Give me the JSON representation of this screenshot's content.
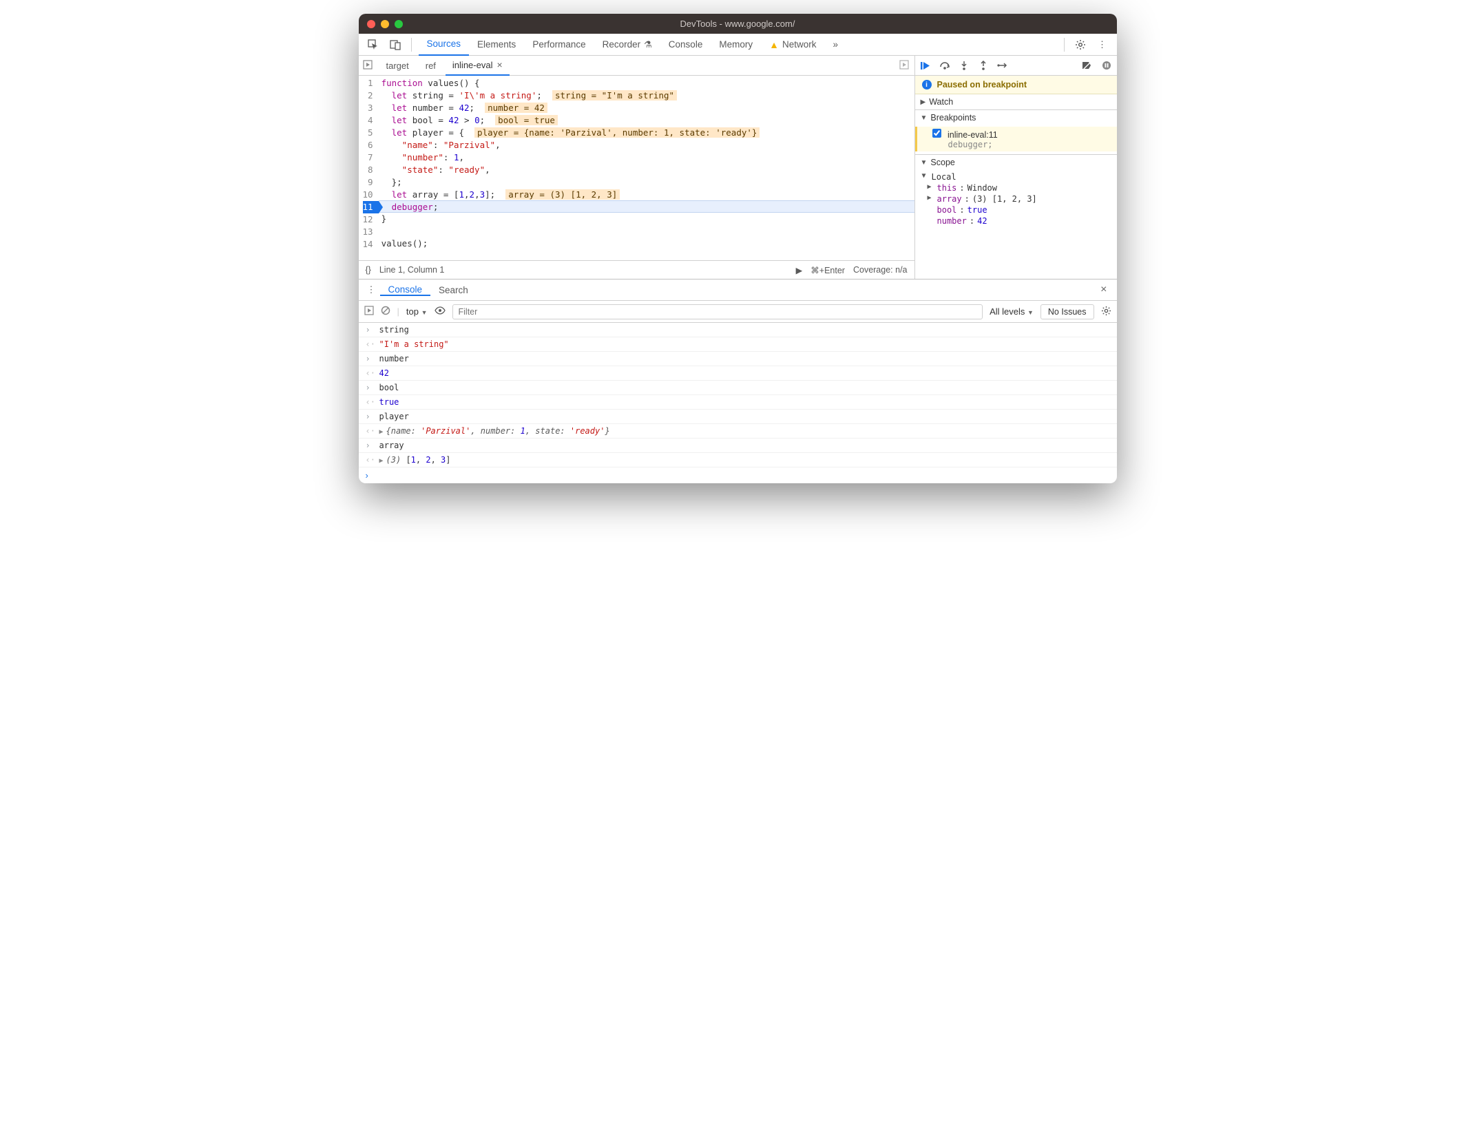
{
  "window": {
    "title": "DevTools - www.google.com/"
  },
  "mainTabs": [
    "Sources",
    "Elements",
    "Performance",
    "Recorder",
    "Console",
    "Memory",
    "Network"
  ],
  "mainTabActive": "Sources",
  "editorTabs": [
    {
      "label": "target",
      "active": false
    },
    {
      "label": "ref",
      "active": false
    },
    {
      "label": "inline-eval",
      "active": true,
      "closeable": true
    }
  ],
  "code": {
    "lines": [
      {
        "n": 1,
        "html": "<span class='tok-kw'>function</span> values() {"
      },
      {
        "n": 2,
        "html": "  <span class='tok-kw'>let</span> string = <span class='tok-str'>'I\\'m a string'</span>;  <span class='inline-eval'>string = \"I'm a string\"</span>"
      },
      {
        "n": 3,
        "html": "  <span class='tok-kw'>let</span> number = <span class='tok-num'>42</span>;  <span class='inline-eval'>number = 42</span>"
      },
      {
        "n": 4,
        "html": "  <span class='tok-kw'>let</span> bool = <span class='tok-num'>42</span> &gt; <span class='tok-num'>0</span>;  <span class='inline-eval'>bool = true</span>"
      },
      {
        "n": 5,
        "html": "  <span class='tok-kw'>let</span> player = {  <span class='inline-eval'>player = {name: 'Parzival', number: 1, state: 'ready'}</span>"
      },
      {
        "n": 6,
        "html": "    <span class='tok-prop'>\"name\"</span>: <span class='tok-str'>\"Parzival\"</span>,"
      },
      {
        "n": 7,
        "html": "    <span class='tok-prop'>\"number\"</span>: <span class='tok-num'>1</span>,"
      },
      {
        "n": 8,
        "html": "    <span class='tok-prop'>\"state\"</span>: <span class='tok-str'>\"ready\"</span>,"
      },
      {
        "n": 9,
        "html": "  };"
      },
      {
        "n": 10,
        "html": "  <span class='tok-kw'>let</span> array = [<span class='tok-num'>1</span>,<span class='tok-num'>2</span>,<span class='tok-num'>3</span>];  <span class='inline-eval'>array = (3) [1, 2, 3]</span>"
      },
      {
        "n": 11,
        "html": "  <span class='tok-dbg'>debugger</span>;",
        "current": true
      },
      {
        "n": 12,
        "html": "}"
      },
      {
        "n": 13,
        "html": ""
      },
      {
        "n": 14,
        "html": "values();"
      }
    ]
  },
  "editorStatus": {
    "pretty": "{}",
    "pos": "Line 1, Column 1",
    "runHint": "⌘+Enter",
    "coverage": "Coverage: n/a"
  },
  "debugger": {
    "bannerText": "Paused on breakpoint",
    "sections": {
      "watch": "Watch",
      "breakpoints": "Breakpoints",
      "scope": "Scope"
    },
    "breakpoint": {
      "source": "inline-eval:11",
      "line": "debugger;"
    },
    "scope": {
      "local": "Local",
      "rows": [
        {
          "name": "this",
          "value": "Window",
          "expandable": true
        },
        {
          "name": "array",
          "value": "(3) [1, 2, 3]",
          "expandable": true,
          "cls": "obj"
        },
        {
          "name": "bool",
          "value": "true",
          "cls": "bool"
        },
        {
          "name": "number",
          "value": "42",
          "cls": "num"
        }
      ]
    }
  },
  "drawer": {
    "tabs": [
      "Console",
      "Search"
    ],
    "active": "Console",
    "toolbar": {
      "context": "top",
      "filterPlaceholder": "Filter",
      "levels": "All levels",
      "issues": "No Issues"
    },
    "logs": [
      {
        "dir": "in",
        "html": "string"
      },
      {
        "dir": "out",
        "html": "<span class='cstr'>\"I'm a string\"</span>"
      },
      {
        "dir": "in",
        "html": "number"
      },
      {
        "dir": "out",
        "html": "<span class='cnum'>42</span>"
      },
      {
        "dir": "in",
        "html": "bool"
      },
      {
        "dir": "out",
        "html": "<span class='cbool'>true</span>"
      },
      {
        "dir": "in",
        "html": "player"
      },
      {
        "dir": "out",
        "html": "<span class='expand-tri'>▶</span><span class='cobj'>{name: <span class='v'>'Parzival'</span>, number: <span class='cnum'>1</span>, state: <span class='v'>'ready'</span>}</span>"
      },
      {
        "dir": "in",
        "html": "array"
      },
      {
        "dir": "out",
        "html": "<span class='expand-tri'>▶</span><span class='cobj'>(3) </span>[<span class='cnum'>1</span>, <span class='cnum'>2</span>, <span class='cnum'>3</span>]"
      }
    ]
  }
}
